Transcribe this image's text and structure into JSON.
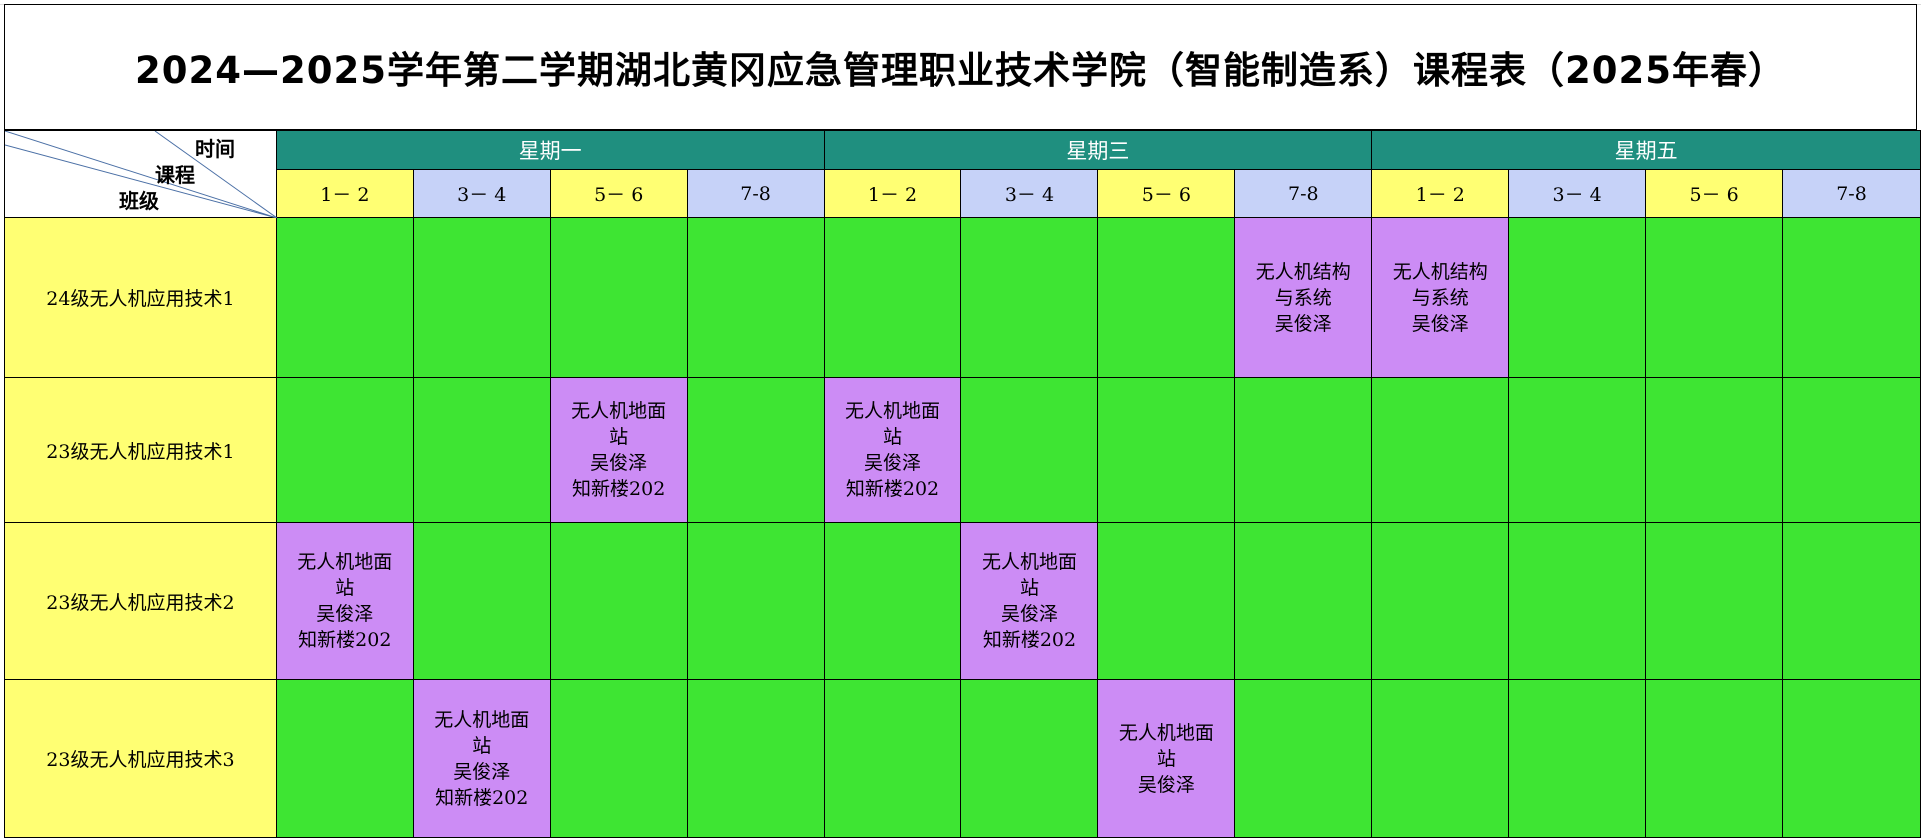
{
  "title": "2024—2025学年第二学期湖北黄冈应急管理职业技术学院（智能制造系）课程表（2025年春）",
  "header": {
    "corner": {
      "time": "时间",
      "course": "课程",
      "class": "班级"
    },
    "days": [
      "星期一",
      "星期三",
      "星期五"
    ],
    "periods": [
      "1－ 2",
      "3－ 4",
      "5－ 6",
      "7-8",
      "1－ 2",
      "3－ 4",
      "5－ 6",
      "7-8",
      "1－ 2",
      "3－ 4",
      "5－ 6",
      "7-8"
    ]
  },
  "colors": {
    "day_header": "#1f8f7f",
    "period_yellow": "#ffff73",
    "period_blue": "#c6d2f8",
    "class_col": "#ffff73",
    "free_slot": "#3ee533",
    "course_slot": "#cc8cf5"
  },
  "rows": [
    {
      "class": "24级无人机应用技术1",
      "cells": [
        null,
        null,
        null,
        null,
        null,
        null,
        null,
        {
          "lines": [
            "无人机结构",
            "与系统",
            "吴俊泽"
          ]
        },
        {
          "lines": [
            "无人机结构",
            "与系统",
            "吴俊泽"
          ]
        },
        null,
        null,
        null
      ]
    },
    {
      "class": "23级无人机应用技术1",
      "cells": [
        null,
        null,
        {
          "lines": [
            "无人机地面",
            "站",
            "吴俊泽",
            "知新楼202"
          ]
        },
        null,
        {
          "lines": [
            "无人机地面",
            "站",
            "吴俊泽",
            "知新楼202"
          ]
        },
        null,
        null,
        null,
        null,
        null,
        null,
        null
      ]
    },
    {
      "class": "23级无人机应用技术2",
      "cells": [
        {
          "lines": [
            "无人机地面",
            "站",
            "吴俊泽",
            "知新楼202"
          ]
        },
        null,
        null,
        null,
        null,
        {
          "lines": [
            "无人机地面",
            "站",
            "吴俊泽",
            "知新楼202"
          ]
        },
        null,
        null,
        null,
        null,
        null,
        null
      ]
    },
    {
      "class": "23级无人机应用技术3",
      "cells": [
        null,
        {
          "lines": [
            "无人机地面",
            "站",
            "吴俊泽",
            "知新楼202"
          ]
        },
        null,
        null,
        null,
        null,
        {
          "lines": [
            "无人机地面",
            "站",
            "吴俊泽"
          ]
        },
        null,
        null,
        null,
        null,
        null
      ]
    }
  ]
}
